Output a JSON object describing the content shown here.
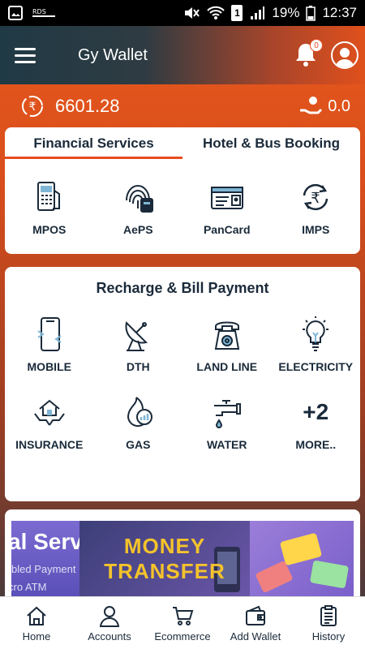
{
  "status_bar": {
    "battery": "19%",
    "time": "12:37",
    "sim": "1"
  },
  "app": {
    "title": "Gy Wallet",
    "notification_count": "0"
  },
  "balance": {
    "main": "6601.28",
    "cashback": "0.0"
  },
  "tabs": [
    {
      "label": "Financial Services",
      "active": true
    },
    {
      "label": "Hotel & Bus Booking",
      "active": false
    }
  ],
  "financial_services": [
    {
      "label": "MPOS",
      "icon": "card-machine-icon"
    },
    {
      "label": "AePS",
      "icon": "fingerprint-icon"
    },
    {
      "label": "PanCard",
      "icon": "id-card-icon"
    },
    {
      "label": "IMPS",
      "icon": "rupee-transfer-icon"
    }
  ],
  "recharge": {
    "title": "Recharge & Bill Payment",
    "row1": [
      {
        "label": "MOBILE",
        "icon": "mobile-icon"
      },
      {
        "label": "DTH",
        "icon": "satellite-dish-icon"
      },
      {
        "label": "LAND LINE",
        "icon": "telephone-icon"
      },
      {
        "label": "ELECTRICITY",
        "icon": "bulb-icon"
      }
    ],
    "row2": [
      {
        "label": "INSURANCE",
        "icon": "house-hands-icon"
      },
      {
        "label": "GAS",
        "icon": "flame-icon"
      },
      {
        "label": "WATER",
        "icon": "tap-icon"
      },
      {
        "label": "MORE..",
        "icon": "plus-two",
        "badge": "+2"
      }
    ]
  },
  "banner": {
    "left_text": "al Services",
    "left_sub1": "bled Payment",
    "left_sub2": "cro ATM",
    "center_line1": "MONEY",
    "center_line2": "TRANSFER"
  },
  "bottom_nav": [
    {
      "label": "Home",
      "icon": "home-icon"
    },
    {
      "label": "Accounts",
      "icon": "user-icon"
    },
    {
      "label": "Ecommerce",
      "icon": "cart-icon"
    },
    {
      "label": "Add Wallet",
      "icon": "wallet-icon"
    },
    {
      "label": "History",
      "icon": "clipboard-icon"
    }
  ]
}
